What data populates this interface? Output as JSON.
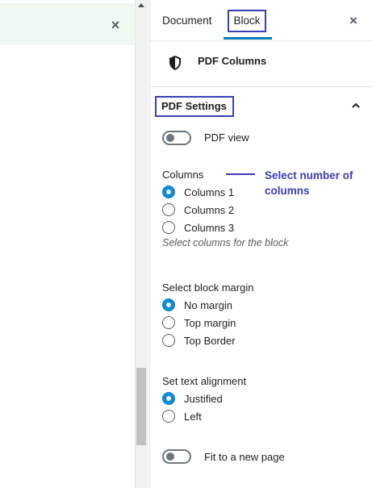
{
  "tabs": {
    "document": "Document",
    "block": "Block"
  },
  "icons": {
    "close": "×",
    "shield": "shield-icon",
    "chevron": "chevron-up-icon"
  },
  "block": {
    "name": "PDF Columns"
  },
  "panel": {
    "title": "PDF Settings"
  },
  "toggles": [
    {
      "label": "PDF view",
      "on": false
    },
    {
      "label": "Fit to a new page",
      "on": false
    }
  ],
  "columns": {
    "label": "Columns",
    "options": [
      "Columns 1",
      "Columns 2",
      "Columns 3"
    ],
    "selected": 0,
    "help": "Select columns for the block"
  },
  "margin": {
    "label": "Select block margin",
    "options": [
      "No margin",
      "Top margin",
      "Top Border"
    ],
    "selected": 0
  },
  "alignment": {
    "label": "Set text alignment",
    "options": [
      "Justified",
      "Left"
    ],
    "selected": 0
  },
  "annotation": {
    "text": "Select number of columns"
  },
  "colors": {
    "accent": "#007cba",
    "radio": "#0a8ad6",
    "annotation": "#3b3fb6",
    "notice": "#eff9f1"
  }
}
